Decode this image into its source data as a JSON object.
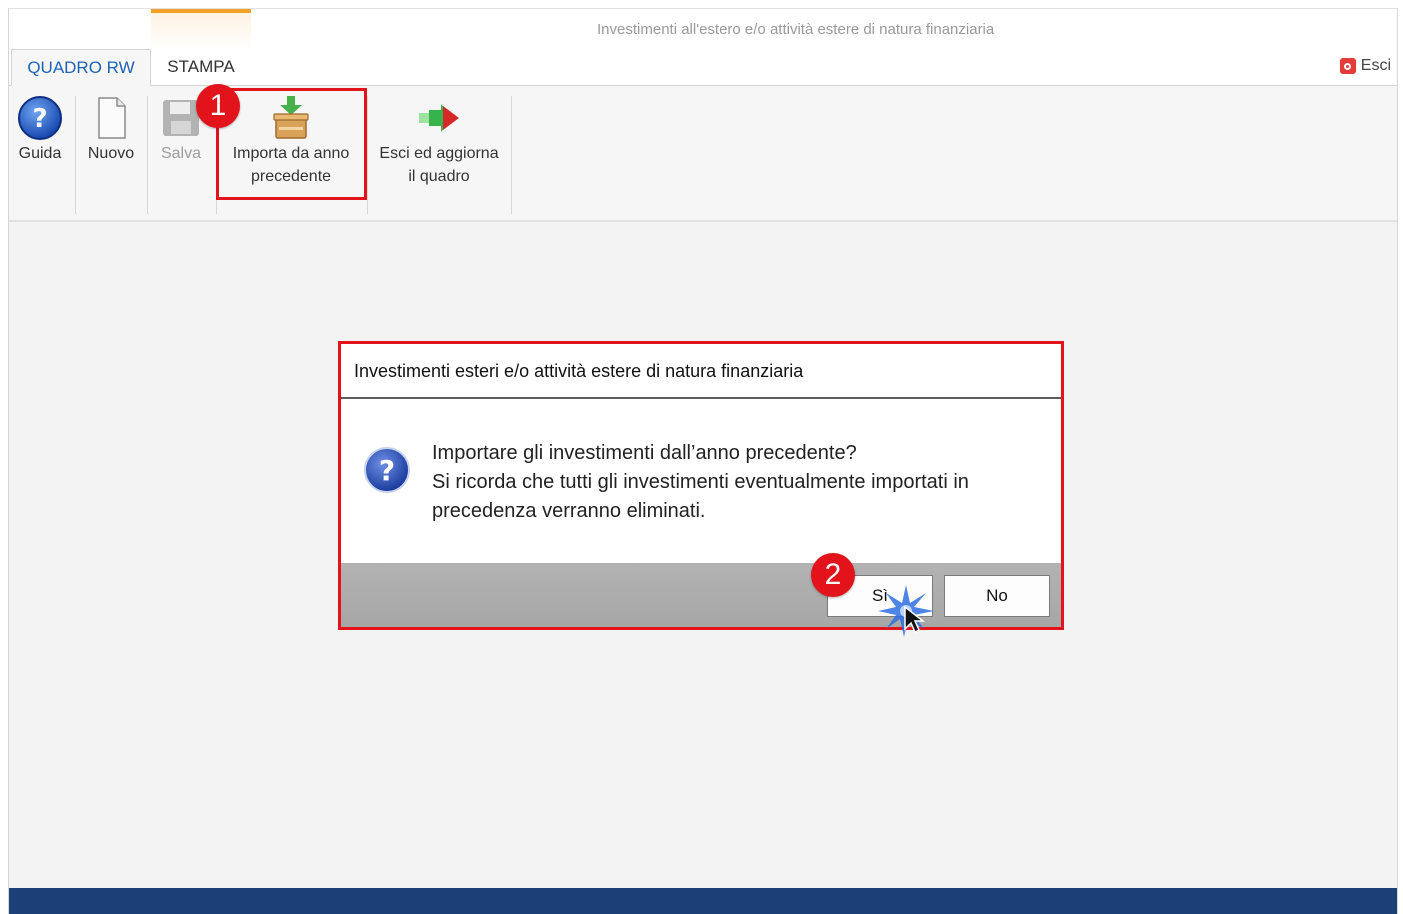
{
  "window": {
    "title": "Investimenti all'estero e/o attività estere di natura finanziaria"
  },
  "tabs": [
    {
      "label": "QUADRO RW",
      "active": true
    },
    {
      "label": "STAMPA",
      "active": false
    }
  ],
  "top_right": {
    "exit_label": "Esci",
    "exit_icon": "power-icon"
  },
  "ribbon": {
    "buttons": [
      {
        "id": "guida",
        "label": "Guida",
        "icon": "help-icon",
        "enabled": true
      },
      {
        "id": "nuovo",
        "label": "Nuovo",
        "icon": "new-document-icon",
        "enabled": true
      },
      {
        "id": "salva",
        "label": "Salva",
        "icon": "save-icon",
        "enabled": false
      },
      {
        "id": "importa",
        "label_line1": "Importa da anno",
        "label_line2": "precedente",
        "icon": "import-box-icon",
        "enabled": true
      },
      {
        "id": "esci_aggiorna",
        "label_line1": "Esci ed aggiorna",
        "label_line2": "il quadro",
        "icon": "exit-arrow-icon",
        "enabled": true
      }
    ]
  },
  "annotations": [
    {
      "number": "1",
      "color": "#e3131b"
    },
    {
      "number": "2",
      "color": "#e3131b"
    }
  ],
  "dialog": {
    "title": "Investimenti esteri e/o attività estere di natura finanziaria",
    "icon": "question-icon",
    "message_lines": [
      "Importare gli investimenti dall’anno precedente?",
      "Si ricorda che tutti gli investimenti eventualmente importati in",
      "precedenza verranno eliminati."
    ],
    "yes_label": "Sì",
    "no_label": "No"
  },
  "colors": {
    "tab_active_text": "#1e62b3",
    "accent_orange": "#f4a12a",
    "callout_red": "#e3131b",
    "statusbar": "#1d3f78"
  }
}
